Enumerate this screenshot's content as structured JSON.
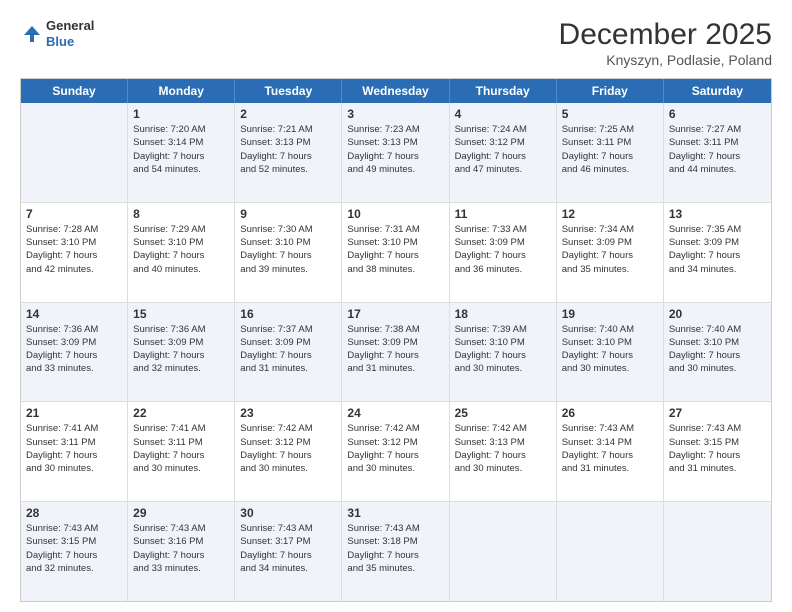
{
  "header": {
    "logo": {
      "general": "General",
      "blue": "Blue"
    },
    "month": "December 2025",
    "location": "Knyszyn, Podlasie, Poland"
  },
  "weekdays": [
    "Sunday",
    "Monday",
    "Tuesday",
    "Wednesday",
    "Thursday",
    "Friday",
    "Saturday"
  ],
  "rows": [
    [
      {
        "day": "",
        "info": ""
      },
      {
        "day": "1",
        "info": "Sunrise: 7:20 AM\nSunset: 3:14 PM\nDaylight: 7 hours\nand 54 minutes."
      },
      {
        "day": "2",
        "info": "Sunrise: 7:21 AM\nSunset: 3:13 PM\nDaylight: 7 hours\nand 52 minutes."
      },
      {
        "day": "3",
        "info": "Sunrise: 7:23 AM\nSunset: 3:13 PM\nDaylight: 7 hours\nand 49 minutes."
      },
      {
        "day": "4",
        "info": "Sunrise: 7:24 AM\nSunset: 3:12 PM\nDaylight: 7 hours\nand 47 minutes."
      },
      {
        "day": "5",
        "info": "Sunrise: 7:25 AM\nSunset: 3:11 PM\nDaylight: 7 hours\nand 46 minutes."
      },
      {
        "day": "6",
        "info": "Sunrise: 7:27 AM\nSunset: 3:11 PM\nDaylight: 7 hours\nand 44 minutes."
      }
    ],
    [
      {
        "day": "7",
        "info": "Sunrise: 7:28 AM\nSunset: 3:10 PM\nDaylight: 7 hours\nand 42 minutes."
      },
      {
        "day": "8",
        "info": "Sunrise: 7:29 AM\nSunset: 3:10 PM\nDaylight: 7 hours\nand 40 minutes."
      },
      {
        "day": "9",
        "info": "Sunrise: 7:30 AM\nSunset: 3:10 PM\nDaylight: 7 hours\nand 39 minutes."
      },
      {
        "day": "10",
        "info": "Sunrise: 7:31 AM\nSunset: 3:10 PM\nDaylight: 7 hours\nand 38 minutes."
      },
      {
        "day": "11",
        "info": "Sunrise: 7:33 AM\nSunset: 3:09 PM\nDaylight: 7 hours\nand 36 minutes."
      },
      {
        "day": "12",
        "info": "Sunrise: 7:34 AM\nSunset: 3:09 PM\nDaylight: 7 hours\nand 35 minutes."
      },
      {
        "day": "13",
        "info": "Sunrise: 7:35 AM\nSunset: 3:09 PM\nDaylight: 7 hours\nand 34 minutes."
      }
    ],
    [
      {
        "day": "14",
        "info": "Sunrise: 7:36 AM\nSunset: 3:09 PM\nDaylight: 7 hours\nand 33 minutes."
      },
      {
        "day": "15",
        "info": "Sunrise: 7:36 AM\nSunset: 3:09 PM\nDaylight: 7 hours\nand 32 minutes."
      },
      {
        "day": "16",
        "info": "Sunrise: 7:37 AM\nSunset: 3:09 PM\nDaylight: 7 hours\nand 31 minutes."
      },
      {
        "day": "17",
        "info": "Sunrise: 7:38 AM\nSunset: 3:09 PM\nDaylight: 7 hours\nand 31 minutes."
      },
      {
        "day": "18",
        "info": "Sunrise: 7:39 AM\nSunset: 3:10 PM\nDaylight: 7 hours\nand 30 minutes."
      },
      {
        "day": "19",
        "info": "Sunrise: 7:40 AM\nSunset: 3:10 PM\nDaylight: 7 hours\nand 30 minutes."
      },
      {
        "day": "20",
        "info": "Sunrise: 7:40 AM\nSunset: 3:10 PM\nDaylight: 7 hours\nand 30 minutes."
      }
    ],
    [
      {
        "day": "21",
        "info": "Sunrise: 7:41 AM\nSunset: 3:11 PM\nDaylight: 7 hours\nand 30 minutes."
      },
      {
        "day": "22",
        "info": "Sunrise: 7:41 AM\nSunset: 3:11 PM\nDaylight: 7 hours\nand 30 minutes."
      },
      {
        "day": "23",
        "info": "Sunrise: 7:42 AM\nSunset: 3:12 PM\nDaylight: 7 hours\nand 30 minutes."
      },
      {
        "day": "24",
        "info": "Sunrise: 7:42 AM\nSunset: 3:12 PM\nDaylight: 7 hours\nand 30 minutes."
      },
      {
        "day": "25",
        "info": "Sunrise: 7:42 AM\nSunset: 3:13 PM\nDaylight: 7 hours\nand 30 minutes."
      },
      {
        "day": "26",
        "info": "Sunrise: 7:43 AM\nSunset: 3:14 PM\nDaylight: 7 hours\nand 31 minutes."
      },
      {
        "day": "27",
        "info": "Sunrise: 7:43 AM\nSunset: 3:15 PM\nDaylight: 7 hours\nand 31 minutes."
      }
    ],
    [
      {
        "day": "28",
        "info": "Sunrise: 7:43 AM\nSunset: 3:15 PM\nDaylight: 7 hours\nand 32 minutes."
      },
      {
        "day": "29",
        "info": "Sunrise: 7:43 AM\nSunset: 3:16 PM\nDaylight: 7 hours\nand 33 minutes."
      },
      {
        "day": "30",
        "info": "Sunrise: 7:43 AM\nSunset: 3:17 PM\nDaylight: 7 hours\nand 34 minutes."
      },
      {
        "day": "31",
        "info": "Sunrise: 7:43 AM\nSunset: 3:18 PM\nDaylight: 7 hours\nand 35 minutes."
      },
      {
        "day": "",
        "info": ""
      },
      {
        "day": "",
        "info": ""
      },
      {
        "day": "",
        "info": ""
      }
    ]
  ],
  "alt_rows": [
    0,
    2,
    4
  ]
}
